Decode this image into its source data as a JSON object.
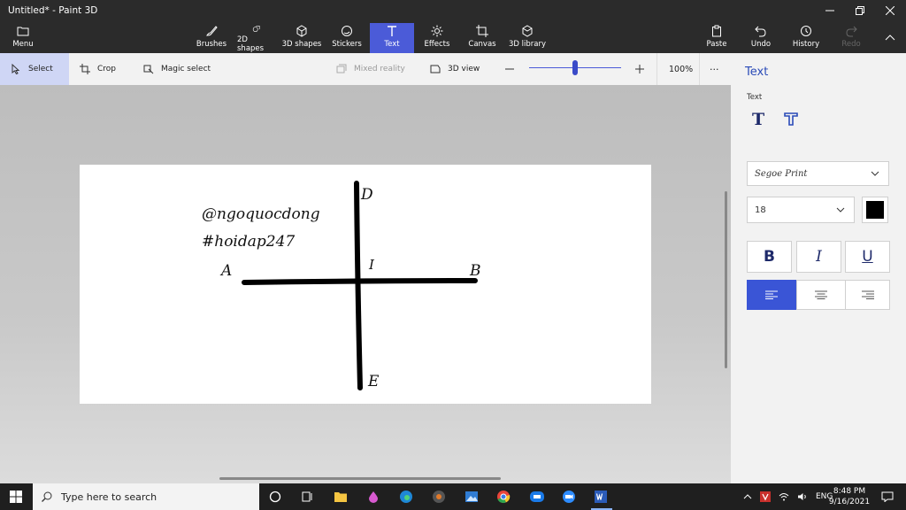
{
  "window": {
    "title": "Untitled* - Paint 3D"
  },
  "ribbon": {
    "menu": "Menu",
    "brushes": "Brushes",
    "shapes2d": "2D shapes",
    "shapes3d": "3D shapes",
    "stickers": "Stickers",
    "text": "Text",
    "effects": "Effects",
    "canvas": "Canvas",
    "library3d": "3D library",
    "paste": "Paste",
    "undo": "Undo",
    "history": "History",
    "redo": "Redo"
  },
  "toolbar": {
    "select": "Select",
    "crop": "Crop",
    "magic_select": "Magic select",
    "mixed_reality": "Mixed reality",
    "view3d": "3D view",
    "zoom": "100%",
    "zoom_fraction": 0.5,
    "more": "···"
  },
  "canvas": {
    "line1": "@ngoquocdong",
    "line2": "#hoidap247",
    "label_a": "A",
    "label_b": "B",
    "label_d": "D",
    "label_e": "E",
    "label_i": "I"
  },
  "panel": {
    "title": "Text",
    "subtitle": "Text",
    "font": "Segoe Print",
    "size": "18",
    "bold": "B",
    "italic": "I",
    "underline": "U",
    "text_color": "#000000",
    "accent": "#3a55d6"
  },
  "taskbar": {
    "search_placeholder": "Type here to search",
    "language": "ENG",
    "time": "8:48 PM",
    "date": "9/16/2021"
  }
}
